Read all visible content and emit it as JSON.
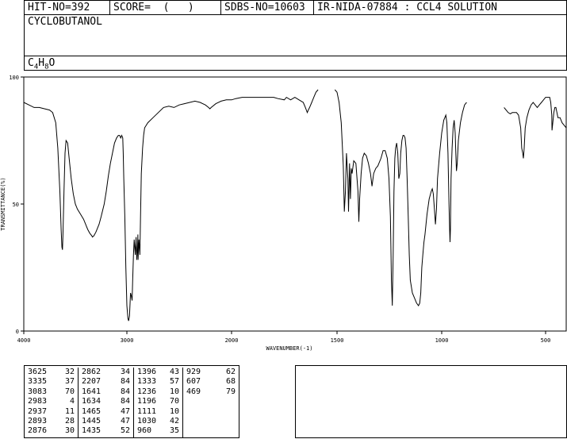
{
  "header": {
    "hit_no": "HIT-NO=392",
    "score": "SCORE=  (   )",
    "sdbs_no": "SDBS-NO=10603",
    "ir_nida": "IR-NIDA-07884 : CCL4 SOLUTION"
  },
  "compound": {
    "name": "CYCLOBUTANOL",
    "formula_parts": [
      "C",
      "4",
      "H",
      "8",
      "O"
    ]
  },
  "chart_data": {
    "type": "line",
    "xlabel": "WAVENUMBER(-1)",
    "ylabel": "TRANSMITTANCE(%)",
    "xlim": [
      4000,
      400
    ],
    "ylim": [
      0,
      100
    ],
    "x_ticks": [
      "4000",
      "3000",
      "2000",
      "1500",
      "1000",
      "500"
    ],
    "y_ticks": [
      "0",
      "50",
      "100"
    ],
    "series": [
      {
        "points": [
          [
            4000,
            90
          ],
          [
            3950,
            89
          ],
          [
            3900,
            88
          ],
          [
            3850,
            88
          ],
          [
            3800,
            87.5
          ],
          [
            3750,
            87
          ],
          [
            3720,
            86
          ],
          [
            3690,
            82
          ],
          [
            3670,
            72
          ],
          [
            3650,
            55
          ],
          [
            3638,
            40
          ],
          [
            3630,
            33
          ],
          [
            3625,
            32
          ],
          [
            3620,
            38
          ],
          [
            3610,
            55
          ],
          [
            3600,
            70
          ],
          [
            3590,
            75
          ],
          [
            3575,
            74
          ],
          [
            3560,
            68
          ],
          [
            3540,
            60
          ],
          [
            3520,
            54
          ],
          [
            3500,
            50
          ],
          [
            3480,
            48
          ],
          [
            3450,
            46
          ],
          [
            3420,
            44
          ],
          [
            3400,
            42
          ],
          [
            3380,
            40
          ],
          [
            3360,
            38.5
          ],
          [
            3340,
            37.5
          ],
          [
            3335,
            37
          ],
          [
            3320,
            37.5
          ],
          [
            3300,
            39
          ],
          [
            3270,
            42
          ],
          [
            3250,
            45
          ],
          [
            3220,
            50
          ],
          [
            3200,
            55
          ],
          [
            3180,
            61
          ],
          [
            3160,
            66
          ],
          [
            3140,
            70
          ],
          [
            3120,
            74
          ],
          [
            3100,
            76
          ],
          [
            3083,
            77
          ],
          [
            3070,
            77
          ],
          [
            3060,
            76
          ],
          [
            3050,
            77
          ],
          [
            3040,
            76
          ],
          [
            3035,
            70
          ],
          [
            3030,
            60
          ],
          [
            3020,
            45
          ],
          [
            3010,
            25
          ],
          [
            3000,
            10
          ],
          [
            2990,
            5
          ],
          [
            2983,
            4
          ],
          [
            2975,
            6
          ],
          [
            2965,
            15
          ],
          [
            2958,
            14
          ],
          [
            2950,
            12
          ],
          [
            2945,
            20
          ],
          [
            2937,
            30
          ],
          [
            2930,
            36
          ],
          [
            2920,
            30
          ],
          [
            2912,
            37
          ],
          [
            2905,
            28
          ],
          [
            2898,
            34
          ],
          [
            2895,
            38
          ],
          [
            2893,
            28
          ],
          [
            2885,
            36
          ],
          [
            2876,
            30
          ],
          [
            2870,
            45
          ],
          [
            2862,
            62
          ],
          [
            2850,
            72
          ],
          [
            2840,
            77
          ],
          [
            2830,
            80
          ],
          [
            2800,
            82
          ],
          [
            2750,
            84
          ],
          [
            2700,
            86
          ],
          [
            2650,
            88
          ],
          [
            2600,
            88.5
          ],
          [
            2550,
            88
          ],
          [
            2500,
            89
          ],
          [
            2450,
            89.5
          ],
          [
            2400,
            90
          ],
          [
            2350,
            90.5
          ],
          [
            2300,
            90
          ],
          [
            2250,
            89
          ],
          [
            2220,
            88
          ],
          [
            2207,
            87.5
          ],
          [
            2195,
            88
          ],
          [
            2150,
            89.5
          ],
          [
            2100,
            90.5
          ],
          [
            2050,
            91
          ],
          [
            2000,
            91
          ],
          [
            1980,
            91.5
          ],
          [
            1950,
            92
          ],
          [
            1900,
            92
          ],
          [
            1850,
            92
          ],
          [
            1800,
            92
          ],
          [
            1780,
            91.5
          ],
          [
            1750,
            91
          ],
          [
            1740,
            92
          ],
          [
            1720,
            91
          ],
          [
            1700,
            92
          ],
          [
            1680,
            91
          ],
          [
            1660,
            90
          ],
          [
            1650,
            88
          ],
          [
            1641,
            86
          ],
          [
            1636,
            87
          ],
          [
            1630,
            88
          ],
          [
            1620,
            90
          ],
          [
            1610,
            92
          ],
          [
            1600,
            94
          ],
          [
            1590,
            95
          ],
          null,
          [
            1510,
            95
          ],
          [
            1500,
            94
          ],
          [
            1490,
            90
          ],
          [
            1480,
            82
          ],
          [
            1470,
            65
          ],
          [
            1465,
            47
          ],
          [
            1460,
            55
          ],
          [
            1455,
            70
          ],
          [
            1448,
            60
          ],
          [
            1445,
            47
          ],
          [
            1440,
            66
          ],
          [
            1436,
            52
          ],
          [
            1432,
            64
          ],
          [
            1428,
            62
          ],
          [
            1420,
            67
          ],
          [
            1410,
            66
          ],
          [
            1400,
            55
          ],
          [
            1396,
            43
          ],
          [
            1392,
            52
          ],
          [
            1385,
            62
          ],
          [
            1378,
            68
          ],
          [
            1370,
            70
          ],
          [
            1360,
            69
          ],
          [
            1350,
            66
          ],
          [
            1340,
            62
          ],
          [
            1333,
            57
          ],
          [
            1325,
            62
          ],
          [
            1315,
            64
          ],
          [
            1305,
            65
          ],
          [
            1290,
            68
          ],
          [
            1280,
            71
          ],
          [
            1270,
            71
          ],
          [
            1260,
            68
          ],
          [
            1252,
            60
          ],
          [
            1245,
            45
          ],
          [
            1240,
            20
          ],
          [
            1236,
            10
          ],
          [
            1232,
            30
          ],
          [
            1228,
            55
          ],
          [
            1224,
            68
          ],
          [
            1220,
            72
          ],
          [
            1215,
            74
          ],
          [
            1210,
            70
          ],
          [
            1205,
            60
          ],
          [
            1200,
            62
          ],
          [
            1196,
            70
          ],
          [
            1190,
            75
          ],
          [
            1185,
            77
          ],
          [
            1180,
            77
          ],
          [
            1175,
            76
          ],
          [
            1170,
            72
          ],
          [
            1165,
            60
          ],
          [
            1160,
            45
          ],
          [
            1155,
            30
          ],
          [
            1150,
            20
          ],
          [
            1140,
            15
          ],
          [
            1130,
            13
          ],
          [
            1120,
            11
          ],
          [
            1111,
            10
          ],
          [
            1105,
            11
          ],
          [
            1100,
            15
          ],
          [
            1095,
            25
          ],
          [
            1090,
            30
          ],
          [
            1085,
            35
          ],
          [
            1080,
            38
          ],
          [
            1075,
            42
          ],
          [
            1070,
            46
          ],
          [
            1060,
            52
          ],
          [
            1050,
            55
          ],
          [
            1045,
            56
          ],
          [
            1040,
            54
          ],
          [
            1035,
            48
          ],
          [
            1030,
            42
          ],
          [
            1025,
            48
          ],
          [
            1020,
            60
          ],
          [
            1010,
            70
          ],
          [
            1000,
            78
          ],
          [
            990,
            83
          ],
          [
            980,
            85
          ],
          [
            975,
            82
          ],
          [
            970,
            70
          ],
          [
            965,
            50
          ],
          [
            962,
            40
          ],
          [
            960,
            35
          ],
          [
            958,
            40
          ],
          [
            955,
            60
          ],
          [
            950,
            72
          ],
          [
            945,
            80
          ],
          [
            940,
            83
          ],
          [
            935,
            78
          ],
          [
            932,
            70
          ],
          [
            929,
            63
          ],
          [
            925,
            66
          ],
          [
            920,
            75
          ],
          [
            910,
            82
          ],
          [
            900,
            86
          ],
          [
            890,
            89
          ],
          [
            880,
            90
          ],
          null,
          [
            700,
            88
          ],
          [
            690,
            87
          ],
          [
            680,
            86
          ],
          [
            670,
            85.5
          ],
          [
            660,
            86
          ],
          [
            650,
            86
          ],
          [
            640,
            86
          ],
          [
            630,
            85
          ],
          [
            620,
            80
          ],
          [
            615,
            72
          ],
          [
            610,
            70
          ],
          [
            607,
            68
          ],
          [
            603,
            72
          ],
          [
            598,
            80
          ],
          [
            590,
            84
          ],
          [
            580,
            87
          ],
          [
            570,
            89
          ],
          [
            560,
            90
          ],
          [
            550,
            89
          ],
          [
            540,
            88
          ],
          [
            530,
            89
          ],
          [
            520,
            90
          ],
          [
            510,
            91
          ],
          [
            500,
            92
          ],
          [
            490,
            92
          ],
          [
            480,
            92
          ],
          [
            475,
            90
          ],
          [
            470,
            85
          ],
          [
            469,
            79
          ],
          [
            465,
            82
          ],
          [
            460,
            86
          ],
          [
            455,
            88
          ],
          [
            450,
            88
          ],
          [
            445,
            86
          ],
          [
            440,
            84
          ],
          [
            430,
            84
          ],
          [
            420,
            82
          ],
          [
            410,
            81
          ],
          [
            400,
            80
          ]
        ]
      }
    ]
  },
  "peaks": [
    [
      [
        "3625",
        "32"
      ],
      [
        "3335",
        "37"
      ],
      [
        "3083",
        "70"
      ],
      [
        "2983",
        "4"
      ],
      [
        "2937",
        "11"
      ],
      [
        "2893",
        "28"
      ],
      [
        "2876",
        "30"
      ]
    ],
    [
      [
        "2862",
        "34"
      ],
      [
        "2207",
        "84"
      ],
      [
        "1641",
        "84"
      ],
      [
        "1634",
        "84"
      ],
      [
        "1465",
        "47"
      ],
      [
        "1445",
        "47"
      ],
      [
        "1435",
        "52"
      ]
    ],
    [
      [
        "1396",
        "43"
      ],
      [
        "1333",
        "57"
      ],
      [
        "1236",
        "10"
      ],
      [
        "1196",
        "70"
      ],
      [
        "1111",
        "10"
      ],
      [
        "1030",
        "42"
      ],
      [
        "960",
        "35"
      ]
    ],
    [
      [
        "929",
        "62"
      ],
      [
        "607",
        "68"
      ],
      [
        "469",
        "79"
      ]
    ]
  ]
}
